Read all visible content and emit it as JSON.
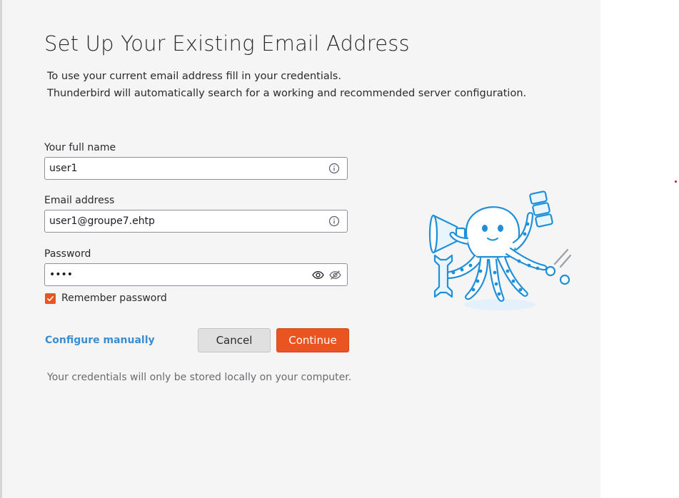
{
  "dialog": {
    "title": "Set Up Your Existing Email Address",
    "intro_line1": "To use your current email address fill in your credentials.",
    "intro_line2": "Thunderbird will automatically search for a working and recommended server configuration."
  },
  "form": {
    "full_name": {
      "label": "Your full name",
      "value": "user1",
      "icon": "info-icon"
    },
    "email": {
      "label": "Email address",
      "value": "user1@groupe7.ehtp",
      "icon": "info-icon"
    },
    "password": {
      "label": "Password",
      "value": "••••",
      "icons": [
        "eye-icon",
        "eye-slash-icon"
      ]
    },
    "remember": {
      "label": "Remember password",
      "checked": true
    }
  },
  "actions": {
    "configure_manually": "Configure manually",
    "cancel": "Cancel",
    "continue": "Continue"
  },
  "footnote": "Your credentials will only be stored locally on your computer.",
  "illustration": {
    "icon": "octopus-mascot-illustration"
  },
  "colors": {
    "accent": "#e95420",
    "link": "#3a8dd1",
    "mascot_stroke": "#1e8fd8",
    "panel_bg": "#f5f5f5"
  }
}
